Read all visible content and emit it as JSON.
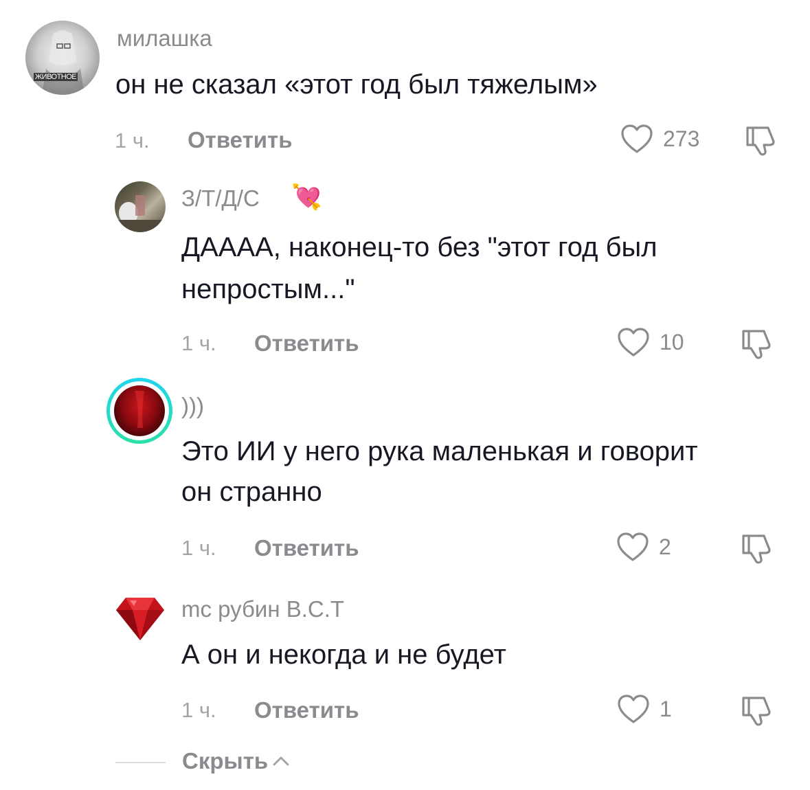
{
  "comments": [
    {
      "username": "милашка",
      "avatar_text": "ЖИВОТНОЕ",
      "text": "он не сказал «этот год был тяжелым»",
      "time": "1 ч.",
      "reply_label": "Ответить",
      "likes": "273"
    },
    {
      "username": "З/Т/Д/С",
      "username_emoji": "💘",
      "text_line1": "ДАААА, наконец-то без \"этот год был",
      "text_line2": "непростым...\"",
      "time": "1 ч.",
      "reply_label": "Ответить",
      "likes": "10"
    },
    {
      "username": ")))",
      "text_line1": "Это ИИ у него рука маленькая и говорит",
      "text_line2": "он странно",
      "time": "1 ч.",
      "reply_label": "Ответить",
      "likes": "2"
    },
    {
      "username": "mc рубин В.С.Т",
      "text": "А он и некогда и не будет",
      "time": "1 ч.",
      "reply_label": "Ответить",
      "likes": "1"
    }
  ],
  "hide_label": "Скрыть",
  "colors": {
    "text": "#161823",
    "muted": "#8a8a8f",
    "story_ring_start": "#20d5ec",
    "story_ring_end": "#2be0a8"
  },
  "icons": [
    "heart-icon",
    "thumb-down-icon",
    "chevron-up-icon"
  ]
}
